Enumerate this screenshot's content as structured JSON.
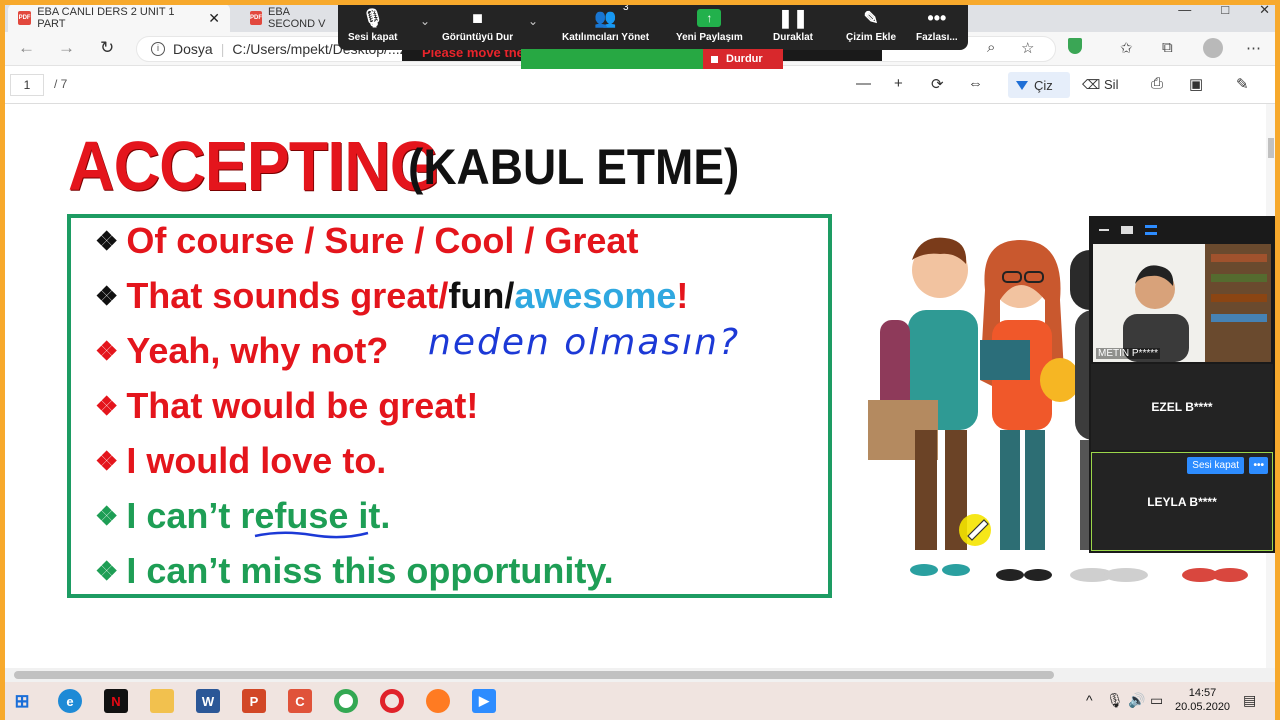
{
  "browser": {
    "tabs": [
      {
        "label": "EBA CANLI DERS 2 UNIT 1 PART",
        "active": true
      },
      {
        "label": "EBA SECOND V",
        "active": false
      }
    ],
    "url_prefix": "Dosya",
    "url": "C:/Users/mpekt/Desktop/...202.20...",
    "window_controls": [
      "—",
      "□",
      "✕"
    ]
  },
  "pdf_toolbar": {
    "page_current": "1",
    "page_total": "/ 7",
    "draw_label": "Çiz",
    "erase_label": "Sil"
  },
  "zoom_toolbar": {
    "buttons": [
      {
        "label": "Sesi kapat",
        "icon": "microphone-icon"
      },
      {
        "label": "Görüntüyü Dur",
        "icon": "video-camera-icon"
      },
      {
        "label": "Katılımcıları Yönet",
        "icon": "participants-icon"
      },
      {
        "label": "Yeni Paylaşım",
        "icon": "share-arrow-icon"
      },
      {
        "label": "Duraklat",
        "icon": "pause-icon"
      },
      {
        "label": "Çizim Ekle",
        "icon": "pencil-icon"
      },
      {
        "label": "Fazlası...",
        "icon": "more-icon"
      }
    ],
    "participant_count": "3",
    "banner_text": "Please move the ... application.",
    "stop_label": "Durdur"
  },
  "slide": {
    "title_main": "ACCEPTING",
    "title_sub": "(KABUL ETME)",
    "lines": [
      {
        "parts": [
          {
            "text": "Of course / Sure / Cool / Great",
            "color": "red"
          }
        ],
        "bullet_color": "black"
      },
      {
        "parts": [
          {
            "text": "That sounds great/",
            "color": "red"
          },
          {
            "text": "fun/",
            "color": "black"
          },
          {
            "text": "awesome",
            "color": "blue"
          },
          {
            "text": "!",
            "color": "red"
          }
        ],
        "bullet_color": "black"
      },
      {
        "parts": [
          {
            "text": "Yeah, why not?",
            "color": "red"
          }
        ],
        "bullet_color": "red"
      },
      {
        "parts": [
          {
            "text": "That would be great!",
            "color": "red"
          }
        ],
        "bullet_color": "red"
      },
      {
        "parts": [
          {
            "text": "I would love to.",
            "color": "red"
          }
        ],
        "bullet_color": "red"
      },
      {
        "parts": [
          {
            "text": "I can’t refuse it.",
            "color": "green"
          }
        ],
        "bullet_color": "green"
      },
      {
        "parts": [
          {
            "text": "I can’t miss this opportunity.",
            "color": "green"
          }
        ],
        "bullet_color": "green"
      }
    ],
    "handwriting": "neden olmasın?"
  },
  "zoom_panel": {
    "video_name": "METIN P*****",
    "participants": [
      "EZEL B****",
      "LEYLA B****"
    ],
    "mute_label": "Sesi kapat",
    "more_label": "•••"
  },
  "taskbar": {
    "time": "14:57",
    "date": "20.05.2020"
  },
  "colors": {
    "share_border": "#f7a92c",
    "slide_red": "#e4151c",
    "slide_green": "#1e9e55",
    "slide_blue": "#2fa8e0",
    "zoom_dark": "#242424"
  }
}
